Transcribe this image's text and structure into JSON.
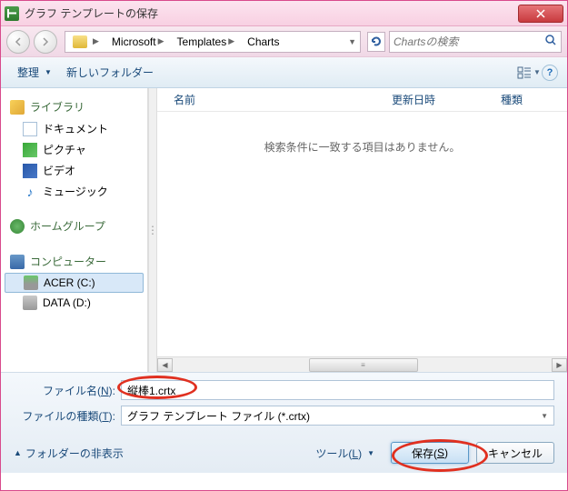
{
  "titlebar": {
    "title": "グラフ テンプレートの保存"
  },
  "breadcrumb": {
    "segments": [
      "Microsoft",
      "Templates",
      "Charts"
    ]
  },
  "search": {
    "placeholder": "Chartsの検索"
  },
  "toolbar": {
    "organize": "整理",
    "new_folder": "新しいフォルダー"
  },
  "sidebar": {
    "libraries": {
      "header": "ライブラリ",
      "items": [
        {
          "label": "ドキュメント"
        },
        {
          "label": "ピクチャ"
        },
        {
          "label": "ビデオ"
        },
        {
          "label": "ミュージック"
        }
      ]
    },
    "homegroup": {
      "header": "ホームグループ"
    },
    "computer": {
      "header": "コンピューター",
      "items": [
        {
          "label": "ACER (C:)"
        },
        {
          "label": "DATA (D:)"
        }
      ]
    }
  },
  "columns": {
    "name": "名前",
    "date": "更新日時",
    "type": "種類"
  },
  "content": {
    "empty": "検索条件に一致する項目はありません。"
  },
  "form": {
    "filename_label_pre": "ファイル名(",
    "filename_label_key": "N",
    "filename_label_post": "):",
    "filename_value": "縦棒1.crtx",
    "filetype_label_pre": "ファイルの種類(",
    "filetype_label_key": "T",
    "filetype_label_post": "):",
    "filetype_value": "グラフ テンプレート ファイル (*.crtx)"
  },
  "footer": {
    "hide_folders": "フォルダーの非表示",
    "tools_pre": "ツール(",
    "tools_key": "L",
    "tools_post": ")",
    "save_pre": "保存(",
    "save_key": "S",
    "save_post": ")",
    "cancel": "キャンセル"
  }
}
